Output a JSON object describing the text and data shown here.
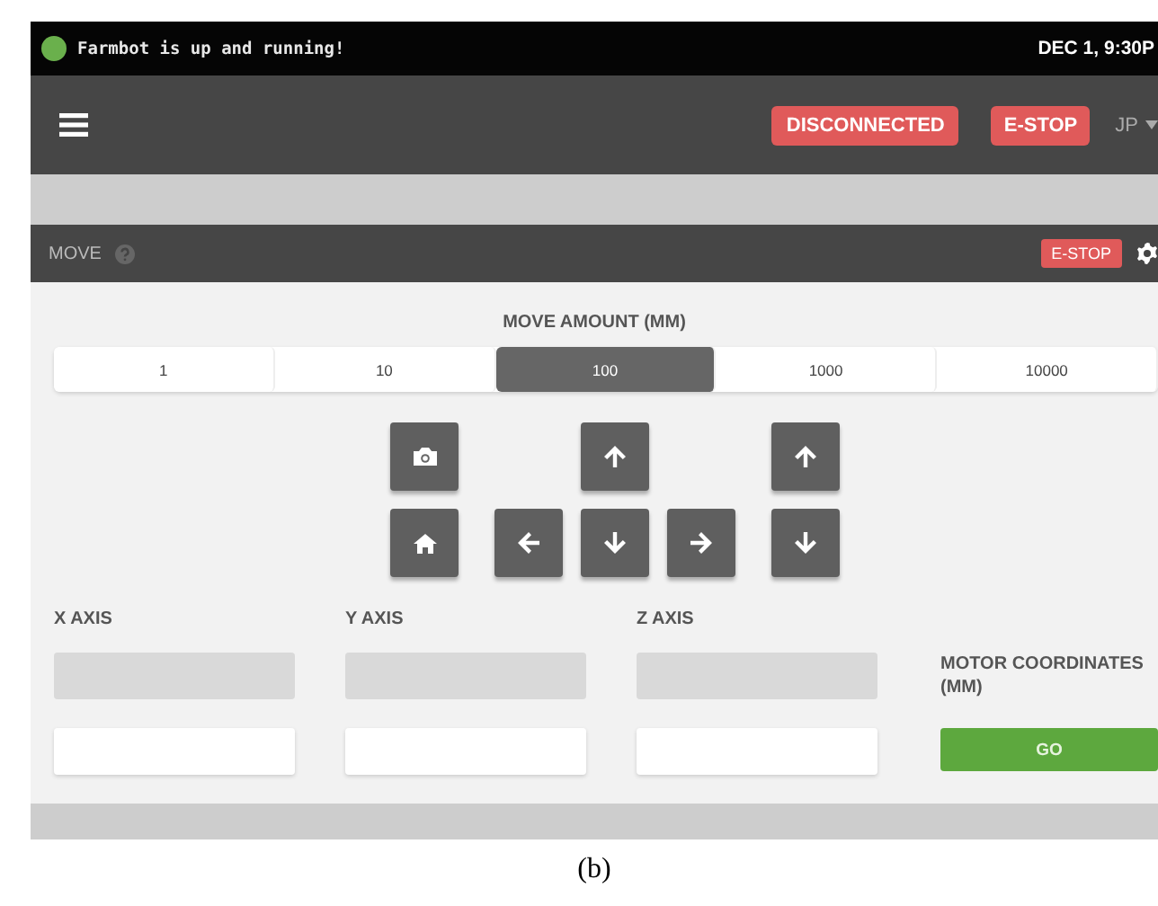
{
  "status_bar": {
    "online": true,
    "text": "Farmbot is up and running!",
    "datetime": "DEC 1, 9:30P"
  },
  "header": {
    "badges": [
      {
        "label": "DISCONNECTED",
        "kind": "status"
      },
      {
        "label": "E-STOP",
        "kind": "estop"
      }
    ],
    "user": "JP"
  },
  "move_panel": {
    "title": "MOVE",
    "estop": "E-STOP",
    "amount_label": "MOVE AMOUNT (MM)",
    "amounts": [
      {
        "label": "1",
        "selected": false
      },
      {
        "label": "10",
        "selected": false
      },
      {
        "label": "100",
        "selected": true
      },
      {
        "label": "1000",
        "selected": false
      },
      {
        "label": "10000",
        "selected": false
      }
    ],
    "jog_buttons": [
      {
        "kind": "camera"
      },
      {
        "kind": "y-up"
      },
      {
        "kind": "z-up"
      },
      {
        "kind": "home"
      },
      {
        "kind": "x-left"
      },
      {
        "kind": "y-down"
      },
      {
        "kind": "x-right"
      },
      {
        "kind": "z-down"
      }
    ],
    "axes": [
      {
        "label": "X AXIS"
      },
      {
        "label": "Y AXIS"
      },
      {
        "label": "Z AXIS"
      }
    ],
    "motor_label": "MOTOR COORDINATES (MM)",
    "go": "GO"
  },
  "caption": "(b)"
}
